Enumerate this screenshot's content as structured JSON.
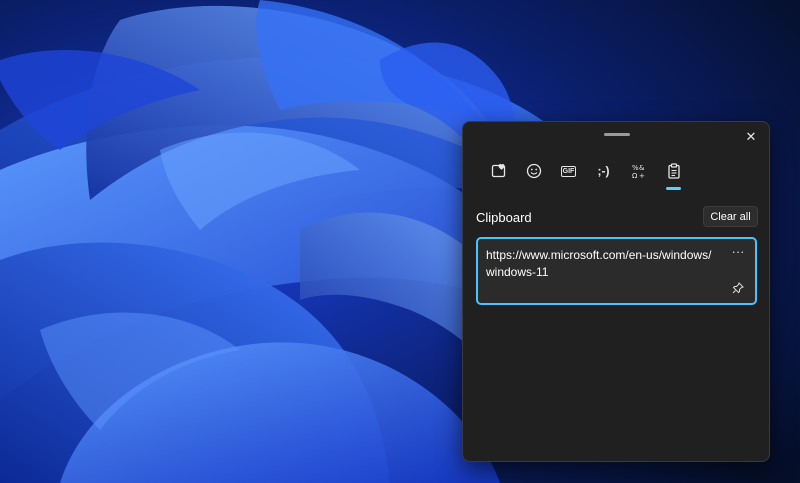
{
  "desktop": {
    "wallpaper_colors": {
      "dark": "#071330",
      "mid": "#1a3fd6",
      "light": "#4f8dff"
    }
  },
  "panel": {
    "tabs": [
      {
        "icon": "favorites-icon",
        "label": "Recently used"
      },
      {
        "icon": "emoji-icon",
        "label": "Emoji"
      },
      {
        "icon": "gif-icon",
        "label": "GIF"
      },
      {
        "icon": "kaomoji-icon",
        "label": ";-)"
      },
      {
        "icon": "symbols-icon",
        "label": "Symbols"
      },
      {
        "icon": "clipboard-icon",
        "label": "Clipboard",
        "active": true
      }
    ],
    "gif_label": "GIF",
    "kaomoji_label": ";-)",
    "section_title": "Clipboard",
    "clear_all_label": "Clear all",
    "items": [
      {
        "text": "https://www.microsoft.com/en-us/windows/windows-11",
        "pinned": false
      }
    ],
    "more_glyph": "···",
    "close_glyph": "✕",
    "accent_color": "#4cc2ff",
    "background": "#202020"
  }
}
